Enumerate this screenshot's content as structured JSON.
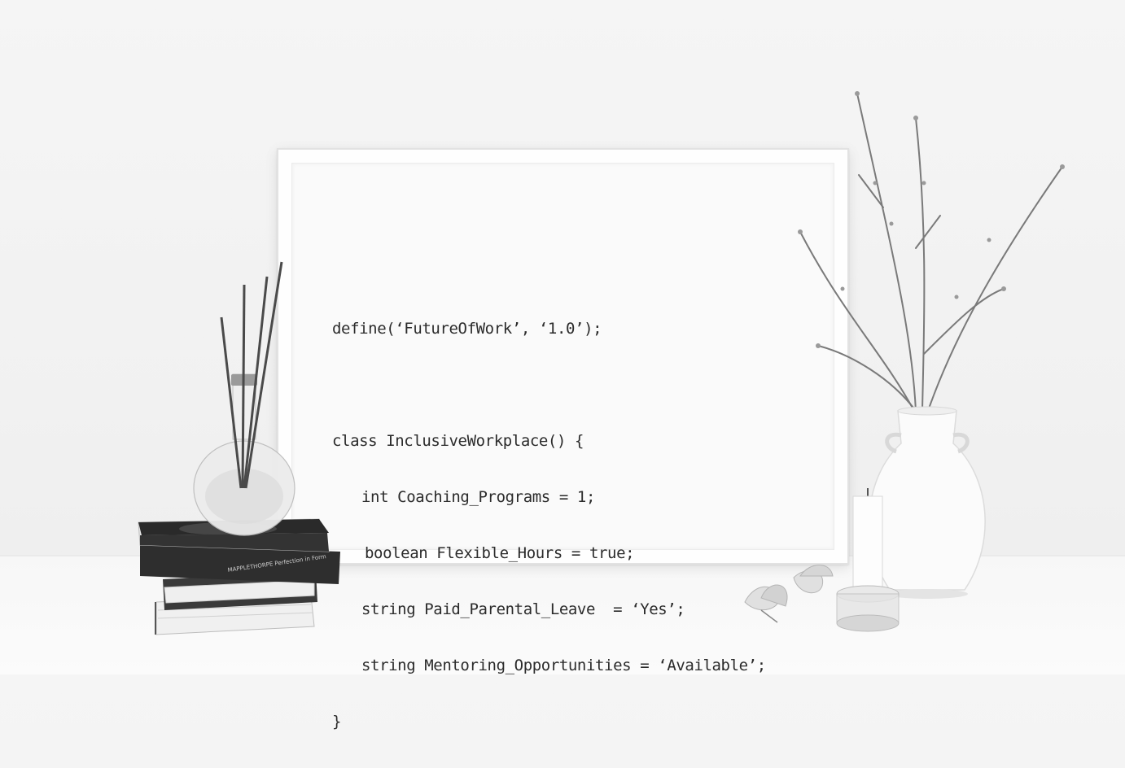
{
  "code": {
    "line1": "define(‘FutureOfWork’, ‘1.0’);",
    "line2": "class InclusiveWorkplace() {",
    "line3": "int Coaching_Programs = 1;",
    "line4": "boolean Flexible_Hours = true;",
    "line5": "string Paid_Parental_Leave  = ‘Yes’;",
    "line6": "string Mentoring_Opportunities = ‘Available’;",
    "line7": "}"
  },
  "books": {
    "spine_text": "MAPPLETHORPE Perfection in Form"
  },
  "colors": {
    "wall": "#f3f3f3",
    "frame": "#fefefe",
    "text": "#2b2b2b",
    "book_dark": "#2e2e2e"
  }
}
